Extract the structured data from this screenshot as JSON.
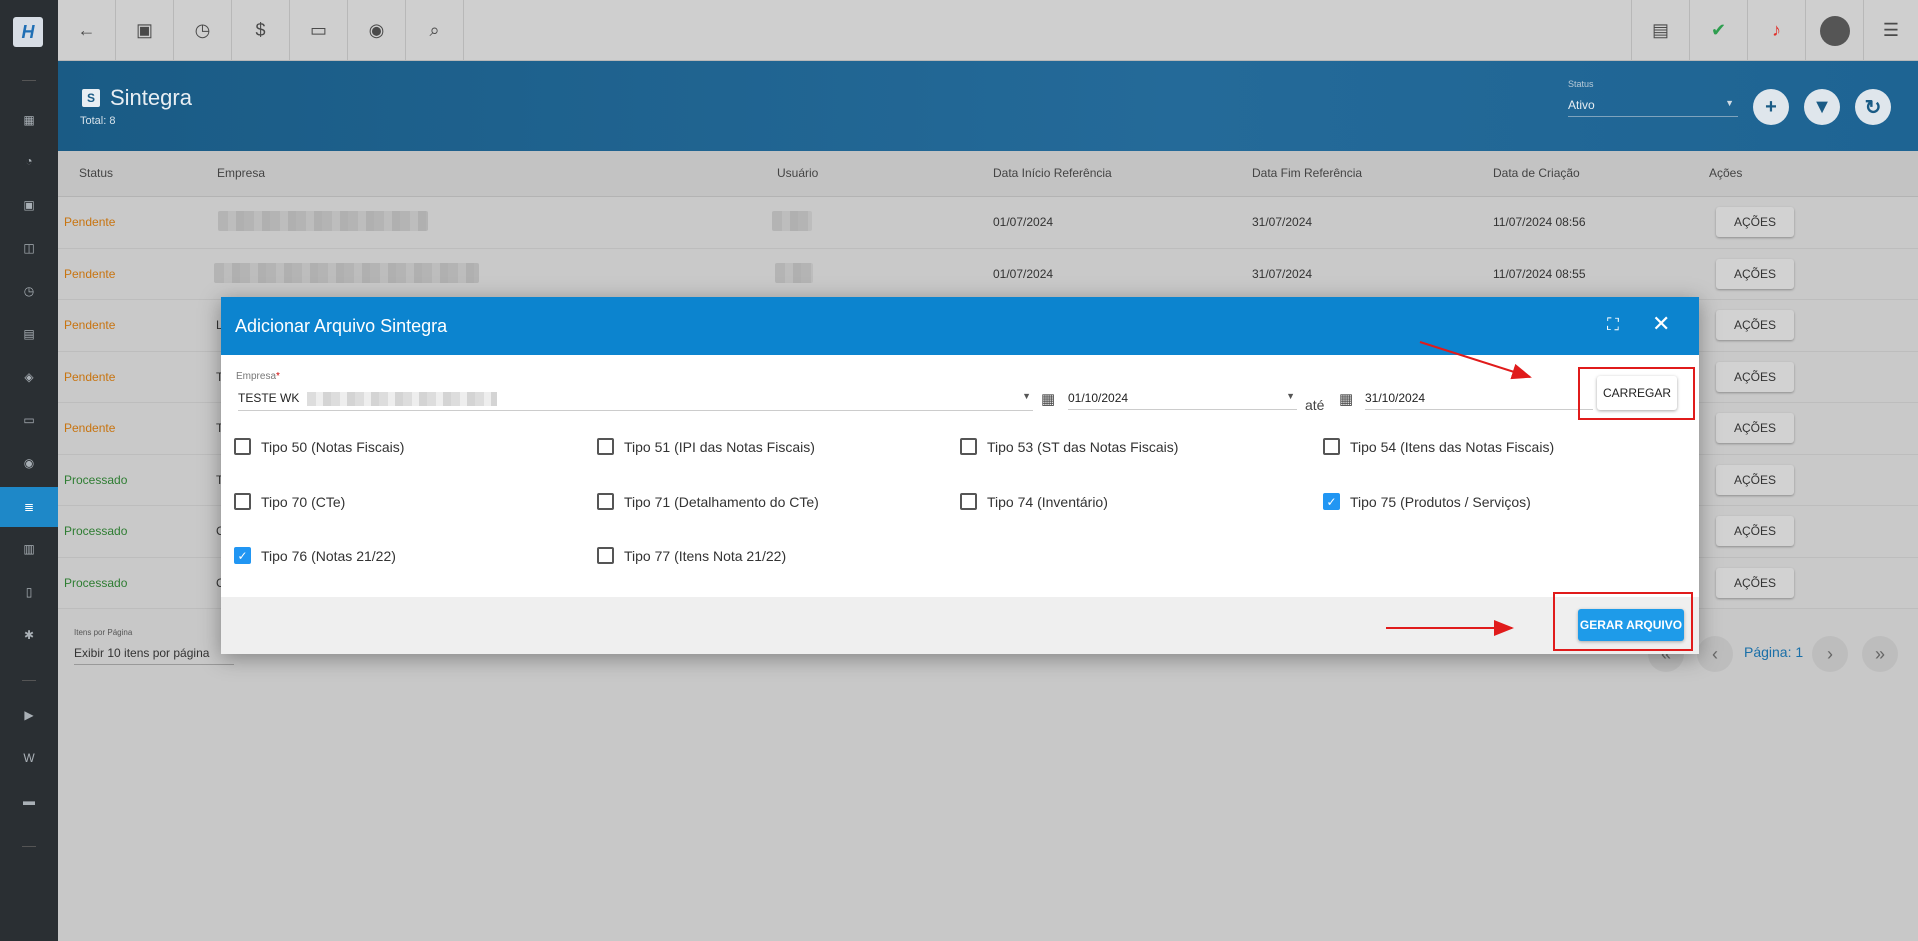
{
  "topbar": {
    "left_icons": [
      "back-arrow-icon",
      "contact-card-icon",
      "calendar-clock-icon",
      "dollar-icon",
      "terminal-icon",
      "eye-icon",
      "search-icon"
    ],
    "right_icons": [
      "pdf-icon",
      "check-message-icon",
      "alarm-bell-icon",
      "user-avatar-icon",
      "menu-list-icon"
    ]
  },
  "header": {
    "icon_letter": "S",
    "title": "Sintegra",
    "total": "Total: 8",
    "status_label": "Status",
    "status_value": "Ativo"
  },
  "table": {
    "columns": [
      "Status",
      "Empresa",
      "Usuário",
      "Data Início Referência",
      "Data Fim Referência",
      "Data de Criação",
      "Ações"
    ],
    "rows": [
      {
        "status": "Pendente",
        "inicio": "01/07/2024",
        "fim": "31/07/2024",
        "criacao": "11/07/2024 08:56",
        "acoes": "AÇÕES"
      },
      {
        "status": "Pendente",
        "inicio": "01/07/2024",
        "fim": "31/07/2024",
        "criacao": "11/07/2024 08:55",
        "acoes": "AÇÕES"
      },
      {
        "status": "Pendente",
        "empresa_initial": "L",
        "acoes": "AÇÕES"
      },
      {
        "status": "Pendente",
        "empresa_initial": "T",
        "acoes": "AÇÕES"
      },
      {
        "status": "Pendente",
        "empresa_initial": "T",
        "acoes": "AÇÕES"
      },
      {
        "status": "Processado",
        "empresa_initial": "T",
        "acoes": "AÇÕES"
      },
      {
        "status": "Processado",
        "empresa_initial": "C",
        "acoes": "AÇÕES"
      },
      {
        "status": "Processado",
        "empresa_initial": "C",
        "acoes": "AÇÕES"
      }
    ]
  },
  "footer": {
    "ipp_label": "Itens por Página",
    "ipp_value": "Exibir 10 itens por página",
    "page_label": "Página: 1"
  },
  "modal": {
    "title": "Adicionar Arquivo Sintegra",
    "empresa_label": "Empresa",
    "empresa_required": "*",
    "empresa_value": "TESTE WK",
    "data_inicio": "01/10/2024",
    "ate": "até",
    "data_fim": "31/10/2024",
    "carregar": "CARREGAR",
    "checkboxes": [
      {
        "label": "Tipo 50 (Notas Fiscais)",
        "checked": false
      },
      {
        "label": "Tipo 51 (IPI das Notas Fiscais)",
        "checked": false
      },
      {
        "label": "Tipo 53 (ST das Notas Fiscais)",
        "checked": false
      },
      {
        "label": "Tipo 54 (Itens das Notas Fiscais)",
        "checked": false
      },
      {
        "label": "Tipo 70 (CTe)",
        "checked": false
      },
      {
        "label": "Tipo 71 (Detalhamento do CTe)",
        "checked": false
      },
      {
        "label": "Tipo 74 (Inventário)",
        "checked": false
      },
      {
        "label": "Tipo 75 (Produtos / Serviços)",
        "checked": true
      },
      {
        "label": "Tipo 76 (Notas 21/22)",
        "checked": true
      },
      {
        "label": "Tipo 77 (Itens Nota 21/22)",
        "checked": false
      }
    ],
    "gerar": "GERAR ARQUIVO"
  },
  "colors": {
    "modal_header": "#0c84cf",
    "pendente": "#c87410",
    "processado": "#2e7d32",
    "highlight": "#e01b1b"
  }
}
